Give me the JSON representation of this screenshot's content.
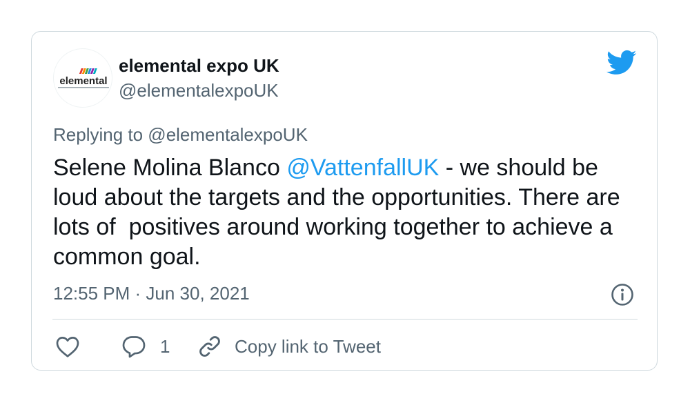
{
  "tweet": {
    "author": {
      "display_name": "elemental expo UK",
      "handle": "@elementalexpoUK",
      "avatar_logo_text": "elemental"
    },
    "replying_to": "Replying to @elementalexpoUK",
    "text": {
      "prefix": "Selene Molina Blanco ",
      "mention": "@VattenfallUK",
      "body": " - we should be loud about the targets and the opportunities. There are lots of  positives around working together to achieve a common goal."
    },
    "timestamp": "12:55 PM · Jun 30, 2021",
    "actions": {
      "reply_count": "1",
      "copy_link_label": "Copy link to Tweet"
    }
  },
  "icons": {
    "brand": "twitter-bird-icon",
    "info": "info-icon",
    "like": "heart-icon",
    "reply": "comment-icon",
    "link": "link-icon"
  },
  "colors": {
    "brand_blue": "#1d9bf0",
    "text_primary": "#0f1419",
    "text_secondary": "#536471",
    "border": "#cfd9de"
  }
}
